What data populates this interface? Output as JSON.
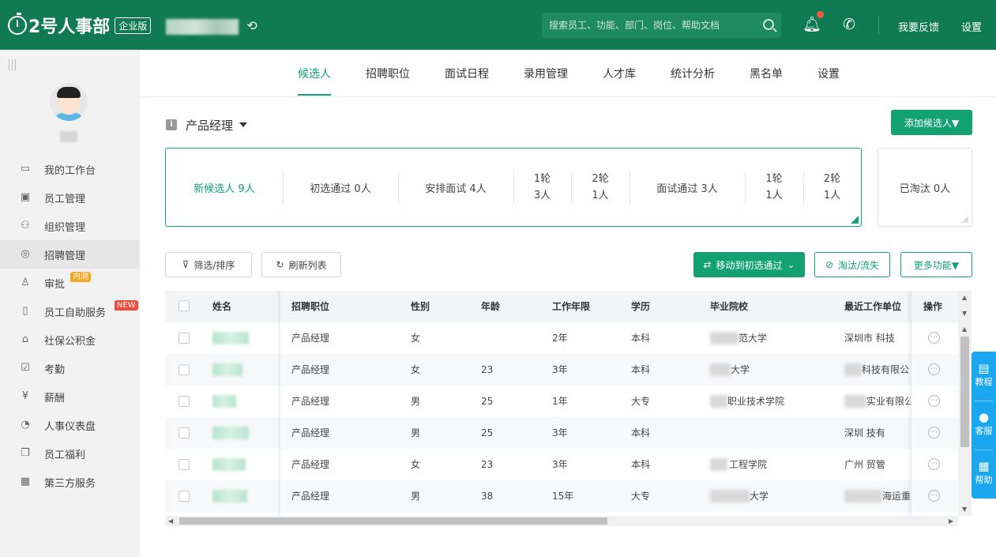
{
  "brand": {
    "name": "2号人事部",
    "edition": "企业版"
  },
  "header": {
    "search_placeholder": "搜索员工、功能、部门、岗位、帮助文档",
    "feedback": "我要反馈",
    "settings": "设置"
  },
  "sidebar": {
    "items": [
      {
        "label": "我的工作台",
        "icon": "monitor-icon"
      },
      {
        "label": "员工管理",
        "icon": "id-card-icon"
      },
      {
        "label": "组织管理",
        "icon": "org-chart-icon"
      },
      {
        "label": "招聘管理",
        "icon": "recruit-search-icon",
        "active": true
      },
      {
        "label": "审批",
        "icon": "stamp-icon",
        "badge": "内测"
      },
      {
        "label": "员工自助服务",
        "icon": "mobile-icon",
        "badge": "NEW"
      },
      {
        "label": "社保公积金",
        "icon": "house-icon"
      },
      {
        "label": "考勤",
        "icon": "calendar-check-icon"
      },
      {
        "label": "薪酬",
        "icon": "yuan-icon"
      },
      {
        "label": "人事仪表盘",
        "icon": "dashboard-icon"
      },
      {
        "label": "员工福利",
        "icon": "gift-icon"
      },
      {
        "label": "第三方服务",
        "icon": "apps-icon"
      }
    ],
    "badge_colors": {
      "内测": "#f5a623",
      "NEW": "#f04a3a"
    }
  },
  "tabs": [
    {
      "label": "候选人",
      "active": true
    },
    {
      "label": "招聘职位"
    },
    {
      "label": "面试日程"
    },
    {
      "label": "录用管理"
    },
    {
      "label": "人才库"
    },
    {
      "label": "统计分析"
    },
    {
      "label": "黑名单"
    },
    {
      "label": "设置"
    }
  ],
  "position_filter": {
    "label": "产品经理"
  },
  "add_candidate_button": "添加候选人▼",
  "pipeline": {
    "new": "新候选人 9人",
    "screen_pass": "初选通过 0人",
    "arrange_interview": "安排面试 4人",
    "arrange_round1": {
      "round": "1轮",
      "count": "3人"
    },
    "arrange_round2": {
      "round": "2轮",
      "count": "1人"
    },
    "interview_pass": "面试通过 3人",
    "pass_round1": {
      "round": "1轮",
      "count": "1人"
    },
    "pass_round2": {
      "round": "2轮",
      "count": "1人"
    },
    "eliminated": "已淘汰 0人"
  },
  "toolbar": {
    "filter": "筛选/排序",
    "refresh": "刷新列表",
    "move": "移动到初选通过",
    "eliminate": "淘汰/流失",
    "more": "更多功能▼"
  },
  "table": {
    "columns": [
      "姓名",
      "招聘职位",
      "性别",
      "年龄",
      "工作年限",
      "学历",
      "毕业院校",
      "最近工作单位",
      "操作"
    ],
    "rows": [
      {
        "position": "产品经理",
        "gender": "女",
        "age": "",
        "years": "2年",
        "education": "本科",
        "school": "范大学",
        "company": "深圳市  科技"
      },
      {
        "position": "产品经理",
        "gender": "女",
        "age": "23",
        "years": "3年",
        "education": "本科",
        "school": "大学",
        "company": "科技有限公"
      },
      {
        "position": "产品经理",
        "gender": "男",
        "age": "25",
        "years": "1年",
        "education": "大专",
        "school": "职业技术学院",
        "company": "实业有限公"
      },
      {
        "position": "产品经理",
        "gender": "男",
        "age": "25",
        "years": "3年",
        "education": "本科",
        "school": "",
        "company": "深圳  技有"
      },
      {
        "position": "产品经理",
        "gender": "女",
        "age": "23",
        "years": "3年",
        "education": "本科",
        "school": "工程学院",
        "company": "广州  贸管"
      },
      {
        "position": "产品经理",
        "gender": "男",
        "age": "38",
        "years": "15年",
        "education": "大专",
        "school": "大学",
        "company": "海运重"
      }
    ]
  },
  "floating": [
    {
      "label": "教程",
      "icon": "id-card-icon"
    },
    {
      "label": "客服",
      "icon": "chat-icon"
    },
    {
      "label": "帮助",
      "icon": "document-icon"
    }
  ],
  "colors": {
    "brand_green": "#0f7a53",
    "accent_green": "#13a172",
    "float_blue": "#1aa7f0"
  }
}
